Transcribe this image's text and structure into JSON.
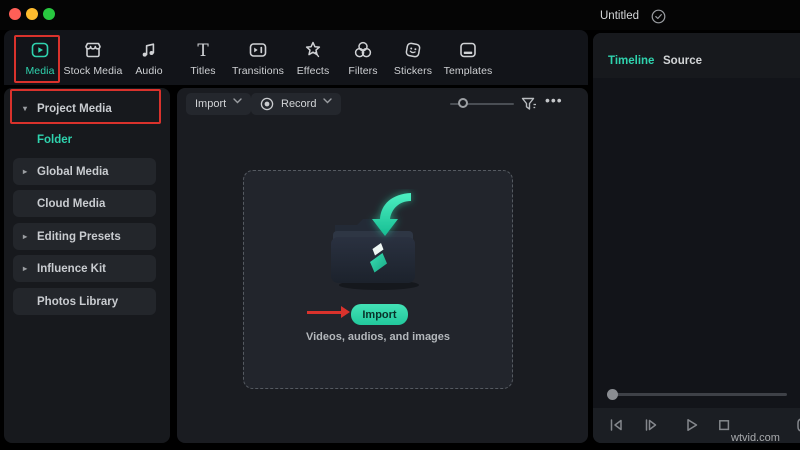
{
  "window": {
    "title": "Untitled"
  },
  "nav": {
    "tabs": [
      {
        "label": "Media",
        "active": true
      },
      {
        "label": "Stock Media"
      },
      {
        "label": "Audio"
      },
      {
        "label": "Titles"
      },
      {
        "label": "Transitions"
      },
      {
        "label": "Effects"
      },
      {
        "label": "Filters"
      },
      {
        "label": "Stickers"
      },
      {
        "label": "Templates"
      }
    ]
  },
  "sidebar": {
    "items": [
      {
        "label": "Project Media",
        "state": "expanded"
      },
      {
        "label": "Folder",
        "state": "selected"
      },
      {
        "label": "Global Media",
        "state": "collapsed"
      },
      {
        "label": "Cloud Media",
        "state": "none"
      },
      {
        "label": "Editing Presets",
        "state": "collapsed"
      },
      {
        "label": "Influence Kit",
        "state": "collapsed"
      },
      {
        "label": "Photos Library",
        "state": "none"
      }
    ]
  },
  "toolbar": {
    "import_label": "Import",
    "record_label": "Record"
  },
  "dropzone": {
    "import_button_label": "Import",
    "hint": "Videos, audios, and images"
  },
  "preview": {
    "tabs": [
      {
        "label": "Timeline",
        "active": true
      },
      {
        "label": "Source"
      }
    ]
  },
  "watermark": "wtvid.com",
  "colors": {
    "accent": "#2fd3ae",
    "annotation": "#d9322c"
  }
}
